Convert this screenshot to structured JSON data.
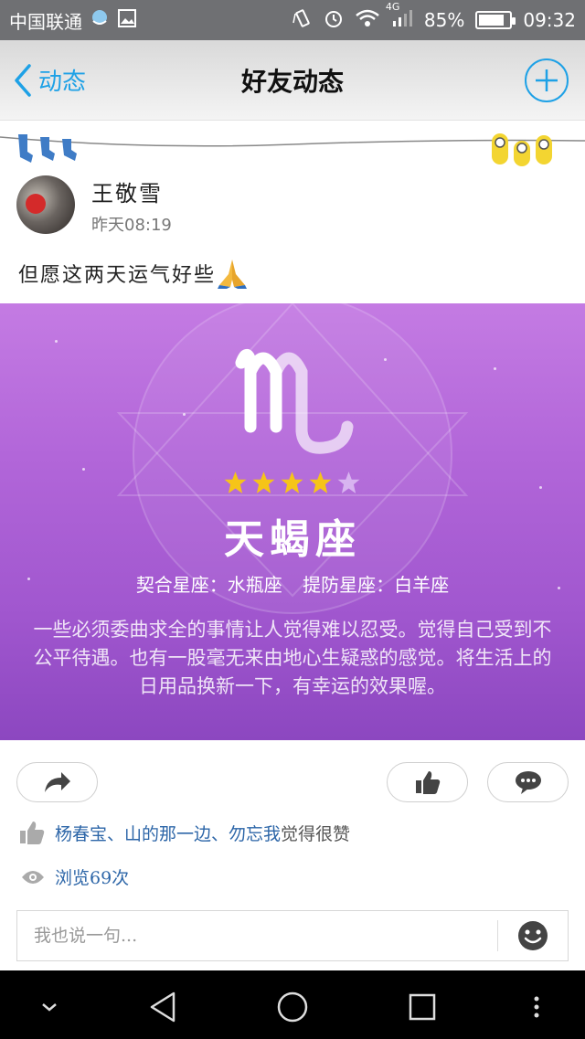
{
  "status_bar": {
    "carrier": "中国联通",
    "network": "4G",
    "battery": "85%",
    "battery_level": 0.85,
    "time": "09:32",
    "icons": [
      "weather-icon",
      "image-icon",
      "vibrate-icon",
      "alarm-icon",
      "wifi-icon",
      "signal-icon",
      "battery-icon"
    ]
  },
  "header": {
    "back_label": "动态",
    "title": "好友动态",
    "accent_color": "#1ea1e6"
  },
  "post": {
    "author": "王敬雪",
    "timestamp": "昨天08:19",
    "text": "但愿这两天运气好些",
    "text_emoji": "pray-hands-icon",
    "horoscope": {
      "sign": "天蝎座",
      "rating": 4,
      "rating_max": 5,
      "match_label": "契合星座：水瓶座",
      "beware_label": "提防星座：白羊座",
      "fortune": "一些必须委曲求全的事情让人觉得难以忍受。觉得自己受到不公平待遇。也有一股毫无来由地心生疑惑的感觉。将生活上的日用品换新一下，有幸运的效果喔。",
      "background_colors": [
        "#c47be3",
        "#8c47c0"
      ]
    },
    "likes_users": "杨春宝、山的那一边、勿忘我",
    "likes_suffix": "觉得很赞",
    "views": "浏览69次"
  },
  "comment": {
    "placeholder": "我也说一句..."
  }
}
